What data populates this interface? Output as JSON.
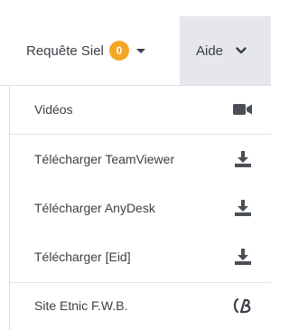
{
  "nav": {
    "requete": {
      "label": "Requête Siel",
      "badge": "0"
    },
    "aide": {
      "label": "Aide"
    }
  },
  "menu": {
    "items": [
      {
        "label": "Vidéos",
        "icon": "video-camera-icon"
      },
      {
        "label": "Télécharger TeamViewer",
        "icon": "download-icon"
      },
      {
        "label": "Télécharger AnyDesk",
        "icon": "download-icon"
      },
      {
        "label": "Télécharger [Eid]",
        "icon": "download-icon"
      },
      {
        "label": "Site Etnic F.W.B.",
        "icon": "etnic-logo-icon"
      }
    ]
  },
  "colors": {
    "badge": "#f5a623",
    "active_tab": "#e5e7ea",
    "text": "#3a3f45",
    "icon": "#4a4f55"
  }
}
